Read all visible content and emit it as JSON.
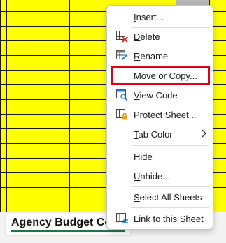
{
  "sheet_tab": {
    "label": "Agency Budget Code"
  },
  "context_menu": {
    "items": [
      {
        "name": "insert",
        "label": "Insert...",
        "ul": "I"
      },
      {
        "name": "delete",
        "label": "Delete",
        "ul": "D",
        "icon": "delete-sheet-icon"
      },
      {
        "name": "rename",
        "label": "Rename",
        "ul": "R",
        "icon": "rename-sheet-icon"
      },
      {
        "name": "move-or-copy",
        "label": "Move or Copy...",
        "ul": "M",
        "highlighted": true
      },
      {
        "name": "view-code",
        "label": "View Code",
        "ul": "V",
        "icon": "view-code-icon"
      },
      {
        "name": "protect-sheet",
        "label": "Protect Sheet...",
        "ul": "P",
        "icon": "protect-sheet-icon"
      },
      {
        "name": "tab-color",
        "label": "Tab Color",
        "ul": "T",
        "submenu": true
      },
      {
        "name": "hide",
        "label": "Hide",
        "ul": "H"
      },
      {
        "name": "unhide",
        "label": "Unhide...",
        "ul": "U"
      },
      {
        "name": "select-all-sheets",
        "label": "Select All Sheets",
        "ul": "S"
      },
      {
        "name": "link-to-sheet",
        "label": "Link to this Sheet",
        "ul": "L",
        "icon": "link-sheet-icon"
      }
    ]
  },
  "colors": {
    "grid_fill": "#ffff00",
    "highlight_border": "#e0001b",
    "tab_underline": "#217346"
  }
}
